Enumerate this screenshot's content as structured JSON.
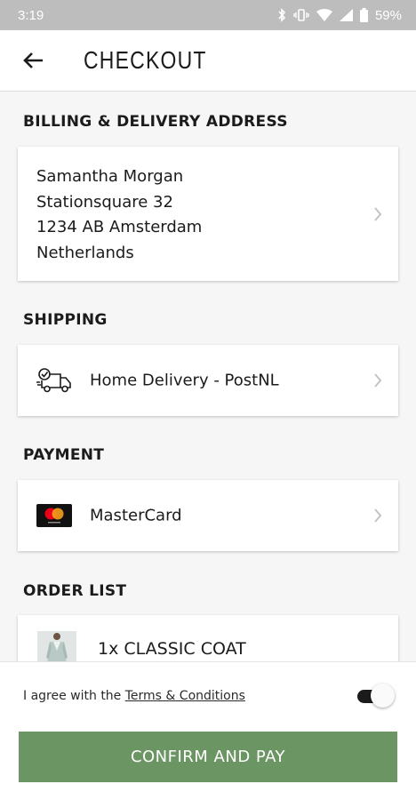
{
  "status_bar": {
    "time": "3:19",
    "battery": "59%"
  },
  "header": {
    "title": "CHECKOUT"
  },
  "sections": {
    "address": {
      "title": "BILLING & DELIVERY ADDRESS",
      "lines": [
        "Samantha Morgan",
        "Stationsquare 32",
        "1234 AB Amsterdam",
        "Netherlands"
      ]
    },
    "shipping": {
      "title": "SHIPPING",
      "method": "Home Delivery - PostNL"
    },
    "payment": {
      "title": "PAYMENT",
      "method": "MasterCard"
    },
    "order": {
      "title": "ORDER LIST",
      "items": [
        {
          "label": "1x CLASSIC COAT"
        }
      ]
    }
  },
  "footer": {
    "agree_prefix": "I agree with the ",
    "terms_link": "Terms & Conditions",
    "toggle_on": true,
    "confirm_label": "CONFIRM AND PAY"
  },
  "colors": {
    "accent_button": "#6b9663",
    "status_bar": "#bdbdbd",
    "mastercard_red": "#eb001b",
    "mastercard_orange": "#f79e1b"
  },
  "icons": [
    "back-arrow-icon",
    "delivery-truck-icon",
    "mastercard-logo-icon",
    "chevron-right-icon",
    "bluetooth-icon",
    "vibrate-icon",
    "wifi-icon",
    "signal-icon",
    "battery-icon"
  ]
}
